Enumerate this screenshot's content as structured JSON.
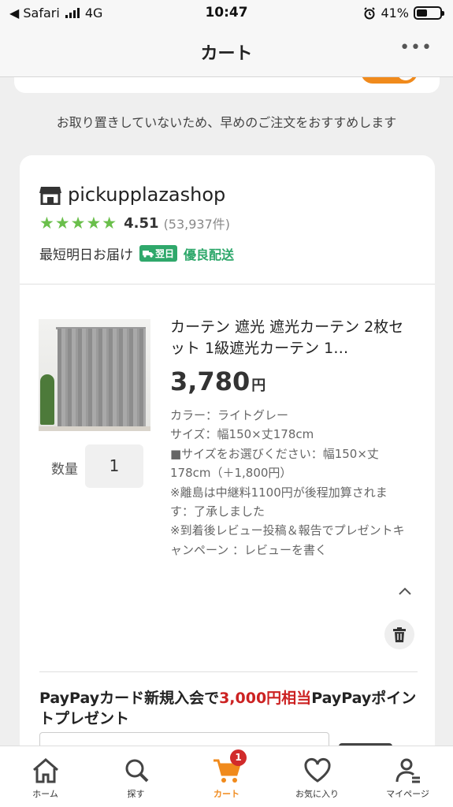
{
  "status": {
    "back_app": "◀ Safari",
    "network": "4G",
    "time": "10:47",
    "battery": "41%"
  },
  "header": {
    "title": "カート",
    "more": "•••"
  },
  "notice": "お取り置きしていないため、早めのご注文をおすすめします",
  "shop": {
    "name": "pickupplazashop",
    "stars": "★★★★★",
    "rating": "4.51",
    "count": "(53,937件)",
    "delivery_label": "最短明日お届け",
    "badge_day": "翌日",
    "badge_text": "優良配送"
  },
  "item": {
    "title": "カーテン 遮光 遮光カーテン 2枚セット 1級遮光カーテン 1…",
    "price": "3,780",
    "price_unit": "円",
    "qty_label": "数量",
    "qty": "1",
    "options": [
      "カラー：ライトグレー",
      "サイズ：幅150×丈178cm",
      "■サイズをお選びください：幅150×丈178cm（＋1,800円）",
      "※離島は中継料1100円が後程加算されます：了承しました",
      "※到着後レビュー投稿＆報告でプレゼントキャンペーン ：レビューを書く"
    ]
  },
  "promo": {
    "text1": "PayPayカード新規入会で",
    "text_red": "3,000円相当",
    "text2": "PayPayポイントプレゼント"
  },
  "tabs": [
    {
      "label": "ホーム",
      "icon": "home-icon"
    },
    {
      "label": "探す",
      "icon": "search-icon"
    },
    {
      "label": "カート",
      "icon": "cart-icon",
      "badge": "1"
    },
    {
      "label": "お気に入り",
      "icon": "heart-icon"
    },
    {
      "label": "マイページ",
      "icon": "user-icon"
    }
  ],
  "colors": {
    "accent": "#f08a1c",
    "star": "#6abf4b",
    "delivery": "#2fa86b",
    "promo_red": "#cc2222",
    "badge": "#d12b2b"
  }
}
